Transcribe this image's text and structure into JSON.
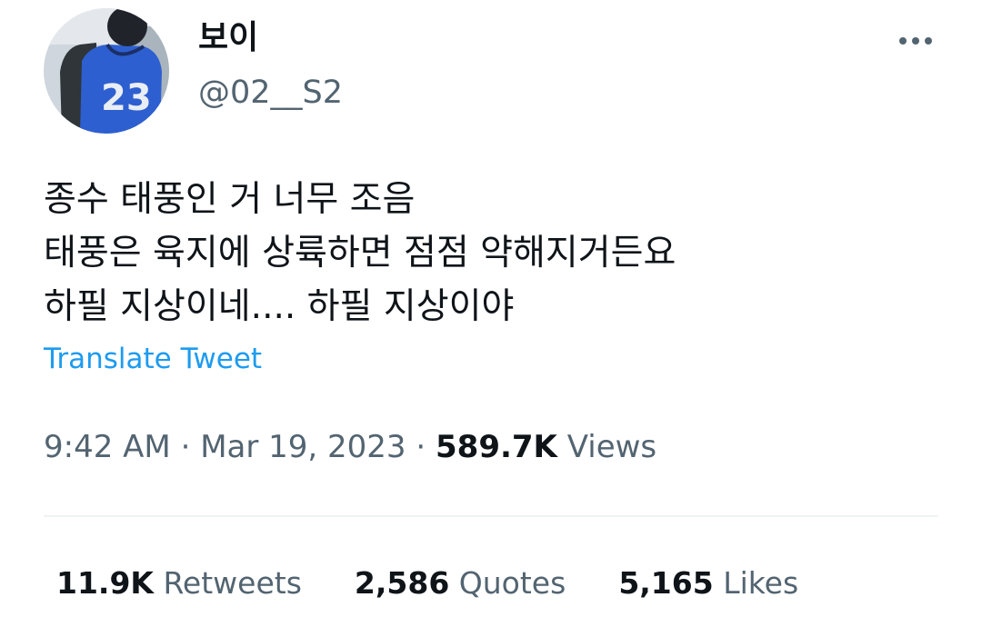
{
  "author": {
    "display_name": "보이",
    "handle": "@02__S2",
    "avatar_jersey_number": "23"
  },
  "tweet": {
    "lines": [
      "종수 태풍인 거 너무 조음",
      "태풍은 육지에 상륙하면 점점 약해지거든요",
      "하필 지상이네.... 하필 지상이야"
    ],
    "translate_label": "Translate Tweet"
  },
  "meta": {
    "time": "9:42 AM",
    "separator": " · ",
    "date": "Mar 19, 2023",
    "views_count": "589.7K",
    "views_label": " Views"
  },
  "stats": {
    "retweets_count": "11.9K",
    "retweets_label": " Retweets",
    "quotes_count": "2,586",
    "quotes_label": " Quotes",
    "likes_count": "5,165",
    "likes_label": " Likes"
  },
  "colors": {
    "text_primary": "#0f1419",
    "text_secondary": "#536471",
    "accent": "#1d9bf0",
    "divider": "#eff3f4"
  },
  "icons": {
    "more": "more-options-icon"
  }
}
